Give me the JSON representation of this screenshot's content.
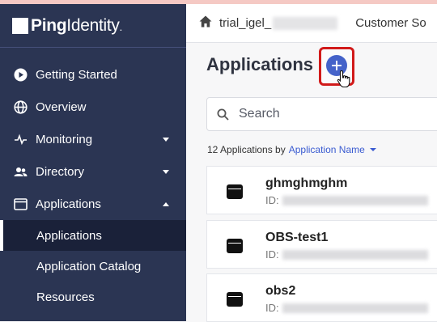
{
  "brand": {
    "name_bold": "Ping",
    "name_light": "Identity",
    "suffix": "."
  },
  "sidebar": {
    "items": [
      {
        "label": "Getting Started",
        "icon": "play-circle-icon"
      },
      {
        "label": "Overview",
        "icon": "globe-icon"
      },
      {
        "label": "Monitoring",
        "icon": "pulse-icon",
        "expandable": true
      },
      {
        "label": "Directory",
        "icon": "users-icon",
        "expandable": true
      },
      {
        "label": "Applications",
        "icon": "window-icon",
        "expandable": true,
        "expanded": true
      }
    ],
    "sub_items": [
      {
        "label": "Applications",
        "active": true
      },
      {
        "label": "Application Catalog"
      },
      {
        "label": "Resources"
      }
    ]
  },
  "header": {
    "environment": "trial_igel_",
    "crumb": "Customer So"
  },
  "main": {
    "title": "Applications",
    "search_placeholder": "Search",
    "count_text": "12 Applications by",
    "sort_label": "Application Name",
    "apps": [
      {
        "name": "ghmghmghm",
        "id_label": "ID:"
      },
      {
        "name": "OBS-test1",
        "id_label": "ID:"
      },
      {
        "name": "obs2",
        "id_label": "ID:"
      }
    ]
  },
  "colors": {
    "sidebar": "#2b3553",
    "accent": "#4462c9",
    "highlight": "#d11a1a"
  }
}
